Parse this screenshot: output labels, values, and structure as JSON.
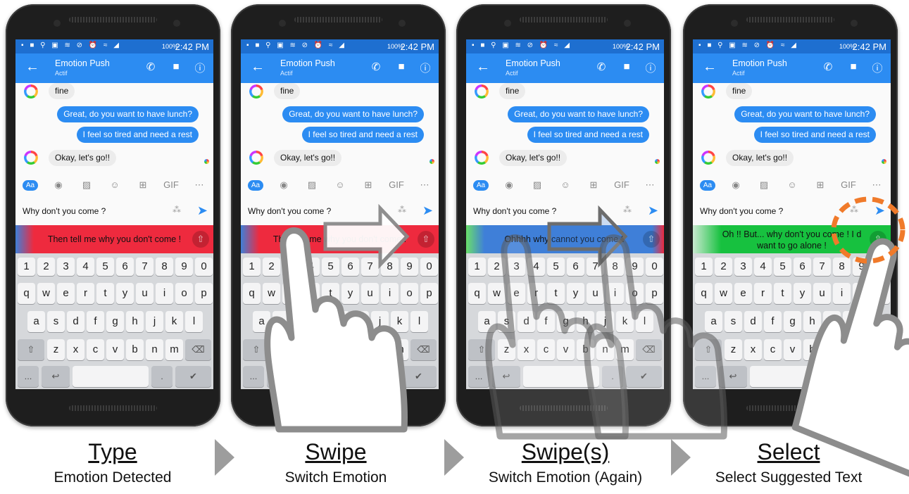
{
  "status": {
    "battery": "100%",
    "time": "2:42 PM"
  },
  "appbar": {
    "title": "Emotion Push",
    "subtitle": "Actif"
  },
  "chat": {
    "incoming_1": "fine",
    "outgoing_1": "Great, do you want to have lunch?",
    "outgoing_2": "I feel so tired and need a rest",
    "incoming_2": "Okay, let's go!!"
  },
  "toolbar": {
    "aa": "Aa",
    "gif": "GIF"
  },
  "composer": {
    "typed": "Why don't you come ?"
  },
  "keyboard": {
    "row1": [
      "1",
      "2",
      "3",
      "4",
      "5",
      "6",
      "7",
      "8",
      "9",
      "0"
    ],
    "row2": [
      "q",
      "w",
      "e",
      "r",
      "t",
      "y",
      "u",
      "i",
      "o",
      "p"
    ],
    "row3": [
      "a",
      "s",
      "d",
      "f",
      "g",
      "h",
      "j",
      "k",
      "l"
    ],
    "row4": [
      "z",
      "x",
      "c",
      "v",
      "b",
      "n",
      "m"
    ],
    "row5": [
      "...",
      "",
      "",
      ".",
      ""
    ]
  },
  "panels": [
    {
      "suggestion": "Then tell me why you don't come !",
      "emotion_color": "#ee2a3e",
      "caption": "Type",
      "caption_sub": "Emotion Detected"
    },
    {
      "suggestion": "Then tell me why you don't come !",
      "emotion_color": "#ee2a3e",
      "caption": "Swipe",
      "caption_sub": "Switch Emotion"
    },
    {
      "suggestion": "Ohhhh why cannot you come ?",
      "emotion_color": "#3f7fd8",
      "caption": "Swipe(s)",
      "caption_sub": "Switch Emotion (Again)"
    },
    {
      "suggestion": "Oh !! But... why don't you come ! I don't want to go alone !",
      "suggestion_line1": "Oh !! But... why don't you come ! I d",
      "suggestion_line2": "want to go alone !",
      "emotion_color": "#17c13f",
      "caption": "Select",
      "caption_sub": "Select Suggested Text"
    }
  ],
  "colors": {
    "status": "#1e6fd0",
    "appbar": "#2c8cf2",
    "highlight": "#f07a2a",
    "arrow": "#9d9d9d"
  }
}
